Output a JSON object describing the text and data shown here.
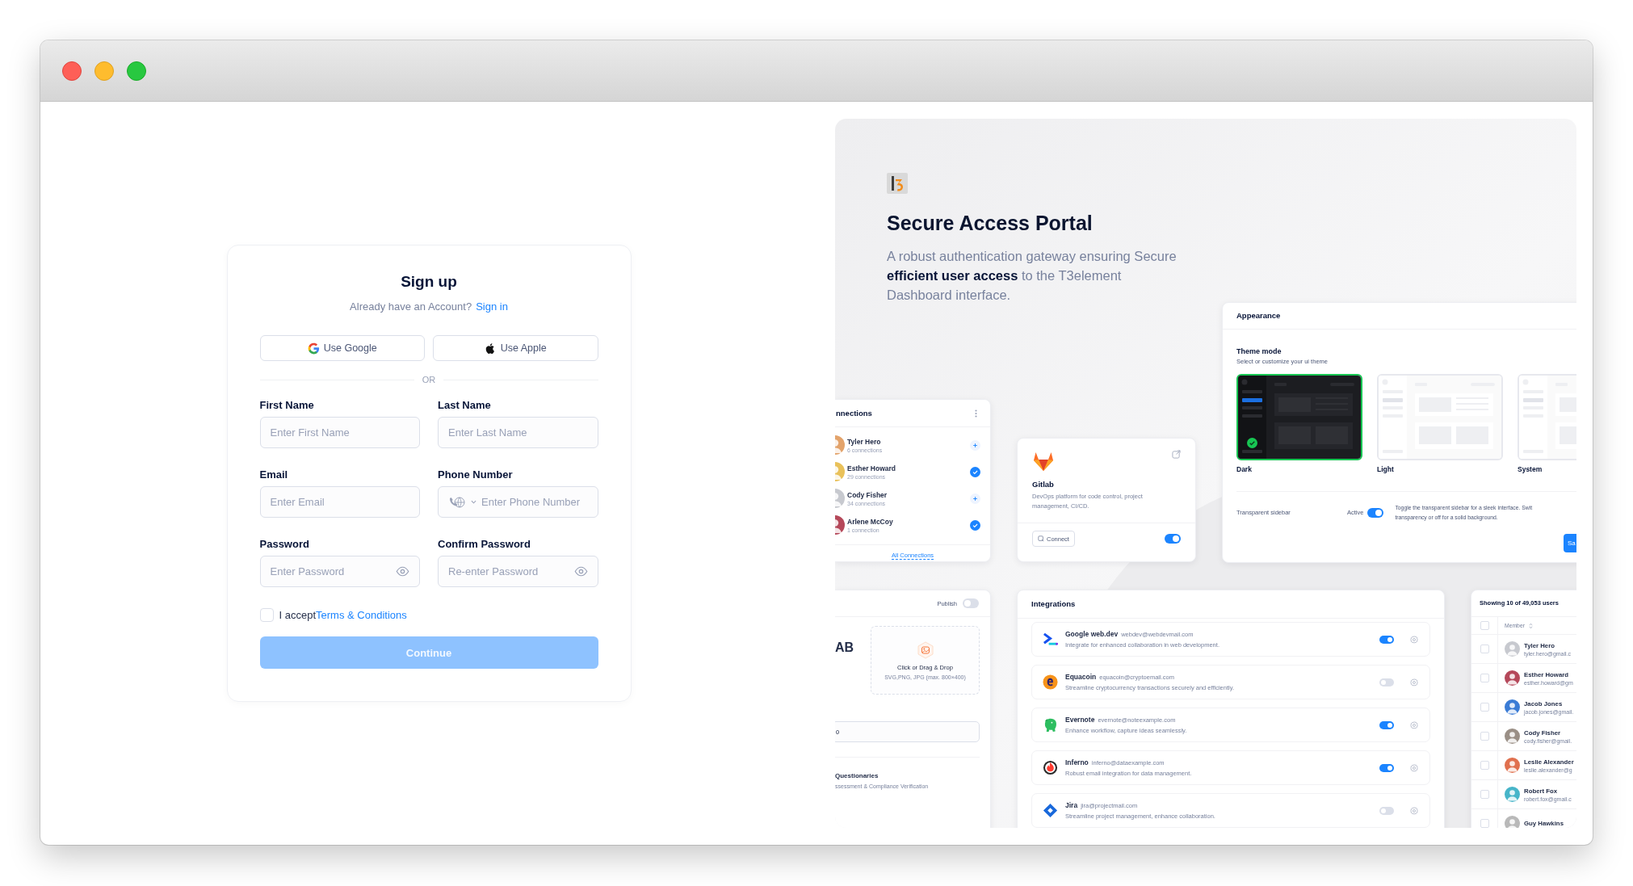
{
  "window": {
    "controls": [
      {
        "kind": "close"
      },
      {
        "kind": "minimize"
      },
      {
        "kind": "zoom"
      }
    ]
  },
  "signup": {
    "title": "Sign up",
    "prompt": "Already have an Account?",
    "prompt_link": "Sign in",
    "social": [
      {
        "kind": "google",
        "label": "Use Google"
      },
      {
        "kind": "apple",
        "label": "Use Apple"
      }
    ],
    "divider": "OR",
    "fields": [
      {
        "label": "First Name",
        "placeholder": "Enter First Name",
        "kind": "text"
      },
      {
        "label": "Last Name",
        "placeholder": "Enter Last Name",
        "kind": "text"
      },
      {
        "label": "Email",
        "placeholder": "Enter Email",
        "kind": "text"
      },
      {
        "label": "Phone Number",
        "placeholder": "Enter Phone Number",
        "kind": "phone"
      },
      {
        "label": "Password",
        "placeholder": "Enter Password",
        "kind": "password"
      },
      {
        "label": "Confirm Password",
        "placeholder": "Re-enter Password",
        "kind": "password"
      }
    ],
    "terms": {
      "checked": false,
      "text": "I accept",
      "link": "Terms & Conditions"
    },
    "submit": {
      "label": "Continue",
      "disabled": true
    }
  },
  "showcase": {
    "title": "Secure Access Portal",
    "description": "A robust authentication gateway ensuring Secure **efficient user access** to the T3element Dashboard interface.",
    "appearance": {
      "title": "Appearance",
      "section_title": "Theme mode",
      "section_hint": "Select or customize your ui theme",
      "themes": [
        {
          "label": "Dark",
          "kind": "dark",
          "selected": true
        },
        {
          "label": "Light",
          "kind": "light",
          "selected": false
        },
        {
          "label": "System",
          "kind": "system",
          "selected": false
        }
      ],
      "setting": {
        "label": "Transparent sidebar",
        "state_label": "Active",
        "on": true,
        "desc_lines": [
          "Toggle the transparent sidebar for a sleek interface. Swit",
          "transparency or off for a solid background."
        ]
      },
      "save_button": "Sa"
    },
    "connections": {
      "title": "nnections",
      "items": [
        {
          "name": "Tyler Hero",
          "count": "6 connections",
          "connected": false
        },
        {
          "name": "Esther Howard",
          "count": "29 connections",
          "connected": true
        },
        {
          "name": "Cody Fisher",
          "count": "34 connections",
          "connected": false
        },
        {
          "name": "Arlene McCoy",
          "count": "1 connection",
          "connected": true
        }
      ],
      "link": "All Connections"
    },
    "gitlab": {
      "name": "Gitlab",
      "description": "DevOps platform for code control, project management, CI/CD.",
      "button": "Connect",
      "on": true
    },
    "publish_card": {
      "publish_label": "Publish",
      "publish_on": false,
      "heading": "AB",
      "upload_title": "Click or Drag & Drop",
      "upload_hint": "SVG,PNG, JPG (max. 800×400)",
      "field_value": "0",
      "section_title": "Questionaries",
      "section_subtitle": "ssessment & Compliance Verification"
    },
    "integrations": {
      "title": "Integrations",
      "items": [
        {
          "name": "Google web.dev",
          "email": "webdev@webdevmail.com",
          "description": "Integrate for enhanced collaboration in web development.",
          "on": true
        },
        {
          "name": "Equacoin",
          "email": "equacoin@cryptoemail.com",
          "description": "Streamline cryptocurrency transactions securely and efficiently.",
          "on": false
        },
        {
          "name": "Evernote",
          "email": "evernote@noteexample.com",
          "description": "Enhance workflow, capture ideas seamlessly.",
          "on": true
        },
        {
          "name": "Inferno",
          "email": "inferno@dataexample.com",
          "description": "Robust email integration for data management.",
          "on": true
        },
        {
          "name": "Jira",
          "email": "jira@projectmail.com",
          "description": "Streamline project management, enhance collaboration.",
          "on": false
        }
      ]
    },
    "users": {
      "summary": "Showing 10 of 49,053 users",
      "column": "Member",
      "all_checked": false,
      "rows": [
        {
          "name": "Tyler Hero",
          "email": "tyler.hero@gmail.c",
          "checked": false
        },
        {
          "name": "Esther Howard",
          "email": "esther.howard@gm",
          "checked": false
        },
        {
          "name": "Jacob Jones",
          "email": "jacob.jones@gmail.",
          "checked": false
        },
        {
          "name": "Cody Fisher",
          "email": "cody.fisher@gmail.",
          "checked": false
        },
        {
          "name": "Leslie Alexander",
          "email": "leslie.alexander@g",
          "checked": false
        },
        {
          "name": "Robert Fox",
          "email": "robert.fox@gmail.c",
          "checked": false
        },
        {
          "name": "Guy Hawkins",
          "checked": false
        }
      ]
    }
  }
}
